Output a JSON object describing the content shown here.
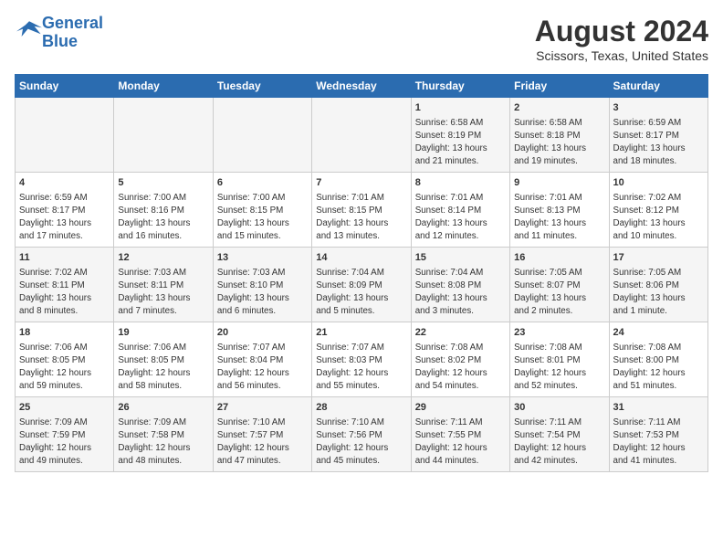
{
  "logo": {
    "line1": "General",
    "line2": "Blue"
  },
  "title": "August 2024",
  "subtitle": "Scissors, Texas, United States",
  "days_of_week": [
    "Sunday",
    "Monday",
    "Tuesday",
    "Wednesday",
    "Thursday",
    "Friday",
    "Saturday"
  ],
  "weeks": [
    [
      {
        "day": "",
        "info": ""
      },
      {
        "day": "",
        "info": ""
      },
      {
        "day": "",
        "info": ""
      },
      {
        "day": "",
        "info": ""
      },
      {
        "day": "1",
        "info": "Sunrise: 6:58 AM\nSunset: 8:19 PM\nDaylight: 13 hours\nand 21 minutes."
      },
      {
        "day": "2",
        "info": "Sunrise: 6:58 AM\nSunset: 8:18 PM\nDaylight: 13 hours\nand 19 minutes."
      },
      {
        "day": "3",
        "info": "Sunrise: 6:59 AM\nSunset: 8:17 PM\nDaylight: 13 hours\nand 18 minutes."
      }
    ],
    [
      {
        "day": "4",
        "info": "Sunrise: 6:59 AM\nSunset: 8:17 PM\nDaylight: 13 hours\nand 17 minutes."
      },
      {
        "day": "5",
        "info": "Sunrise: 7:00 AM\nSunset: 8:16 PM\nDaylight: 13 hours\nand 16 minutes."
      },
      {
        "day": "6",
        "info": "Sunrise: 7:00 AM\nSunset: 8:15 PM\nDaylight: 13 hours\nand 15 minutes."
      },
      {
        "day": "7",
        "info": "Sunrise: 7:01 AM\nSunset: 8:15 PM\nDaylight: 13 hours\nand 13 minutes."
      },
      {
        "day": "8",
        "info": "Sunrise: 7:01 AM\nSunset: 8:14 PM\nDaylight: 13 hours\nand 12 minutes."
      },
      {
        "day": "9",
        "info": "Sunrise: 7:01 AM\nSunset: 8:13 PM\nDaylight: 13 hours\nand 11 minutes."
      },
      {
        "day": "10",
        "info": "Sunrise: 7:02 AM\nSunset: 8:12 PM\nDaylight: 13 hours\nand 10 minutes."
      }
    ],
    [
      {
        "day": "11",
        "info": "Sunrise: 7:02 AM\nSunset: 8:11 PM\nDaylight: 13 hours\nand 8 minutes."
      },
      {
        "day": "12",
        "info": "Sunrise: 7:03 AM\nSunset: 8:11 PM\nDaylight: 13 hours\nand 7 minutes."
      },
      {
        "day": "13",
        "info": "Sunrise: 7:03 AM\nSunset: 8:10 PM\nDaylight: 13 hours\nand 6 minutes."
      },
      {
        "day": "14",
        "info": "Sunrise: 7:04 AM\nSunset: 8:09 PM\nDaylight: 13 hours\nand 5 minutes."
      },
      {
        "day": "15",
        "info": "Sunrise: 7:04 AM\nSunset: 8:08 PM\nDaylight: 13 hours\nand 3 minutes."
      },
      {
        "day": "16",
        "info": "Sunrise: 7:05 AM\nSunset: 8:07 PM\nDaylight: 13 hours\nand 2 minutes."
      },
      {
        "day": "17",
        "info": "Sunrise: 7:05 AM\nSunset: 8:06 PM\nDaylight: 13 hours\nand 1 minute."
      }
    ],
    [
      {
        "day": "18",
        "info": "Sunrise: 7:06 AM\nSunset: 8:05 PM\nDaylight: 12 hours\nand 59 minutes."
      },
      {
        "day": "19",
        "info": "Sunrise: 7:06 AM\nSunset: 8:05 PM\nDaylight: 12 hours\nand 58 minutes."
      },
      {
        "day": "20",
        "info": "Sunrise: 7:07 AM\nSunset: 8:04 PM\nDaylight: 12 hours\nand 56 minutes."
      },
      {
        "day": "21",
        "info": "Sunrise: 7:07 AM\nSunset: 8:03 PM\nDaylight: 12 hours\nand 55 minutes."
      },
      {
        "day": "22",
        "info": "Sunrise: 7:08 AM\nSunset: 8:02 PM\nDaylight: 12 hours\nand 54 minutes."
      },
      {
        "day": "23",
        "info": "Sunrise: 7:08 AM\nSunset: 8:01 PM\nDaylight: 12 hours\nand 52 minutes."
      },
      {
        "day": "24",
        "info": "Sunrise: 7:08 AM\nSunset: 8:00 PM\nDaylight: 12 hours\nand 51 minutes."
      }
    ],
    [
      {
        "day": "25",
        "info": "Sunrise: 7:09 AM\nSunset: 7:59 PM\nDaylight: 12 hours\nand 49 minutes."
      },
      {
        "day": "26",
        "info": "Sunrise: 7:09 AM\nSunset: 7:58 PM\nDaylight: 12 hours\nand 48 minutes."
      },
      {
        "day": "27",
        "info": "Sunrise: 7:10 AM\nSunset: 7:57 PM\nDaylight: 12 hours\nand 47 minutes."
      },
      {
        "day": "28",
        "info": "Sunrise: 7:10 AM\nSunset: 7:56 PM\nDaylight: 12 hours\nand 45 minutes."
      },
      {
        "day": "29",
        "info": "Sunrise: 7:11 AM\nSunset: 7:55 PM\nDaylight: 12 hours\nand 44 minutes."
      },
      {
        "day": "30",
        "info": "Sunrise: 7:11 AM\nSunset: 7:54 PM\nDaylight: 12 hours\nand 42 minutes."
      },
      {
        "day": "31",
        "info": "Sunrise: 7:11 AM\nSunset: 7:53 PM\nDaylight: 12 hours\nand 41 minutes."
      }
    ]
  ]
}
